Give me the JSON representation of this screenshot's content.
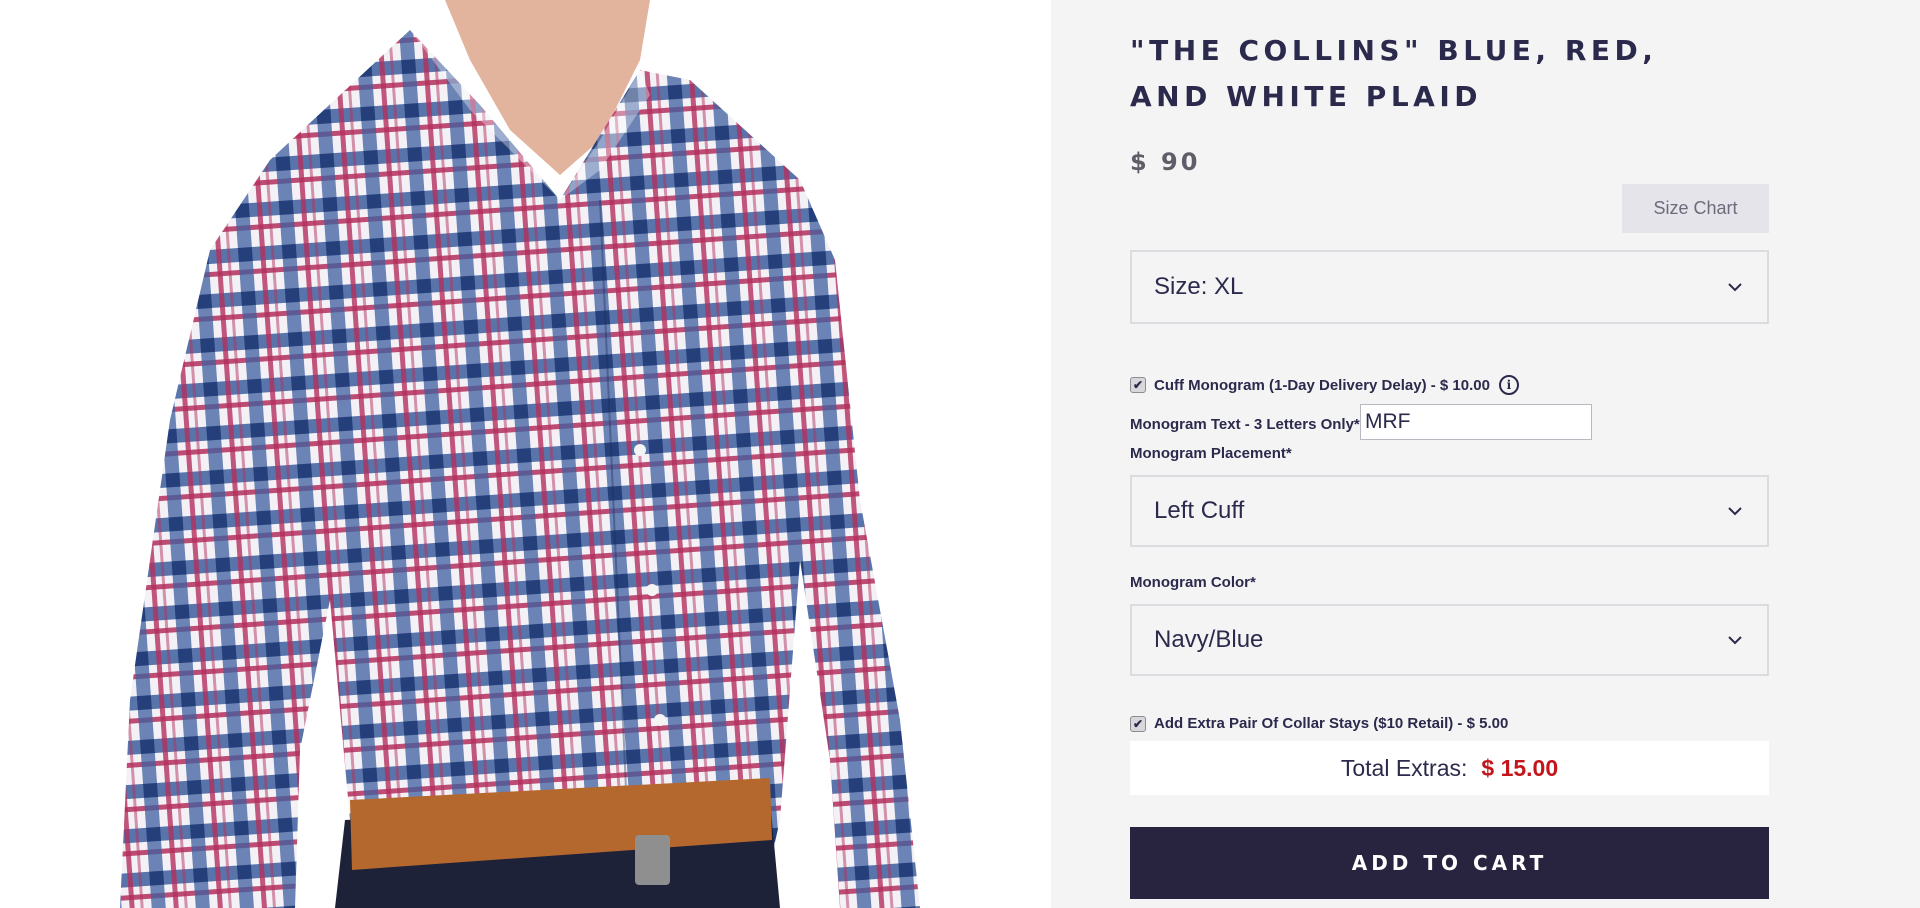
{
  "product": {
    "title": "\"THE COLLINS\" BLUE, RED, AND WHITE PLAID",
    "price": "$ 90"
  },
  "size_chart": {
    "label": "Size Chart"
  },
  "size_select": {
    "value": "Size: XL"
  },
  "cuff_monogram": {
    "checked": true,
    "label": "Cuff Monogram (1-Day Delivery Delay) - $ 10.00",
    "info_icon": "info-icon"
  },
  "monogram_text": {
    "label": "Monogram Text - 3 Letters Only*",
    "value": "MRF"
  },
  "monogram_placement": {
    "label": "Monogram Placement*",
    "value": "Left Cuff"
  },
  "monogram_color": {
    "label": "Monogram Color*",
    "value": "Navy/Blue"
  },
  "collar_stays": {
    "checked": true,
    "label": "Add Extra Pair Of Collar Stays ($10 Retail) - $ 5.00"
  },
  "total_extras": {
    "label": "Total Extras:",
    "amount": "$ 15.00"
  },
  "cart": {
    "label": "ADD TO CART"
  },
  "colors": {
    "navy": "#28243f",
    "accent_red": "#c2161c",
    "panel_bg": "#f4f4f5"
  }
}
